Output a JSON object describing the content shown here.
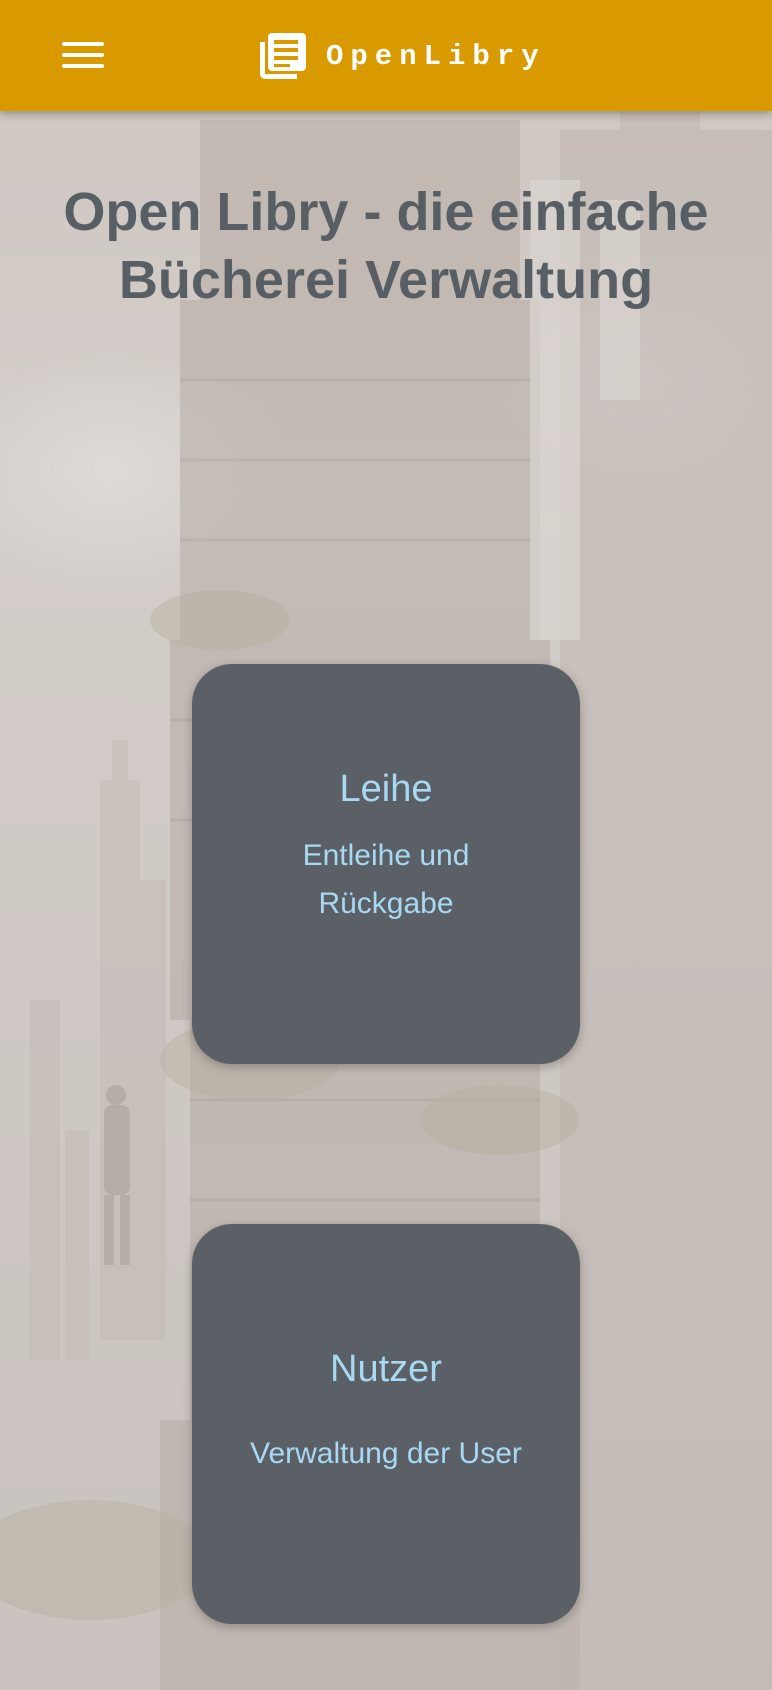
{
  "header": {
    "menu_icon": "hamburger-menu-icon",
    "logo_icon": "newspaper-icon",
    "brand_name": "OpenLibry",
    "background_color": "#d99a00"
  },
  "main": {
    "headline": "Open Libry - die einfache Bücherei Verwaltung",
    "cards": [
      {
        "title": "Leihe",
        "subtitle": "Entleihe und Rückgabe"
      },
      {
        "title": "Nutzer",
        "subtitle": "Verwaltung der User"
      }
    ],
    "card_color": "#5a6066",
    "card_text_color": "#a9d8f2",
    "headline_color": "#585f64"
  }
}
